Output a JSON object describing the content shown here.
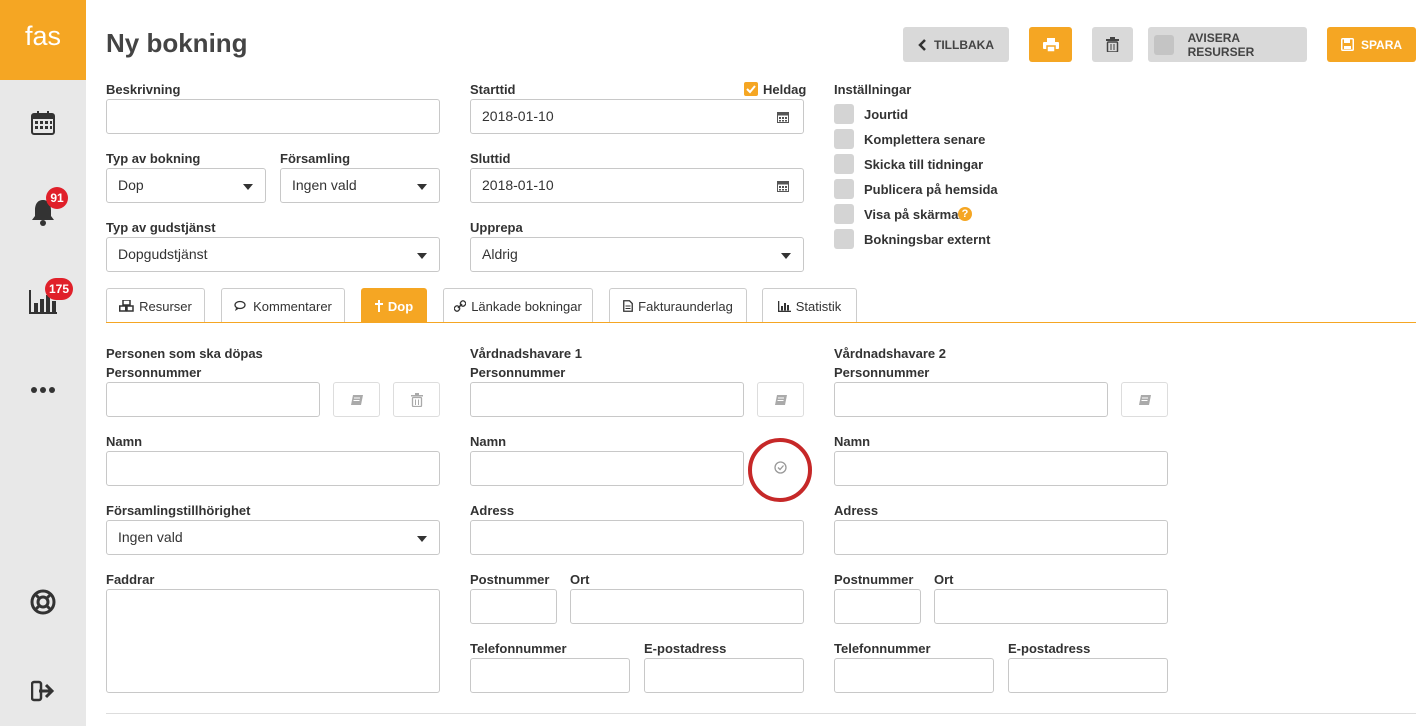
{
  "sidebar": {
    "logo": "fas",
    "notifications_count": "91",
    "stats_count": "175"
  },
  "header": {
    "title": "Ny bokning",
    "back_label": "TILLBAKA",
    "notify_label": "AVISERA RESURSER",
    "save_label": "SPARA"
  },
  "form": {
    "description_label": "Beskrivning",
    "booking_type_label": "Typ av bokning",
    "booking_type_value": "Dop",
    "parish_label": "Församling",
    "parish_value": "Ingen vald",
    "service_type_label": "Typ av gudstjänst",
    "service_type_value": "Dopgudstjänst",
    "start_label": "Starttid",
    "allday_label": "Heldag",
    "start_value": "2018-01-10",
    "end_label": "Sluttid",
    "end_value": "2018-01-10",
    "repeat_label": "Upprepa",
    "repeat_value": "Aldrig"
  },
  "settings": {
    "title": "Inställningar",
    "items": [
      "Jourtid",
      "Komplettera senare",
      "Skicka till tidningar",
      "Publicera på hemsida",
      "Visa på skärmar",
      "Bokningsbar externt"
    ]
  },
  "tabs": [
    "Resurser",
    "Kommentarer",
    "Dop",
    "Länkade bokningar",
    "Fakturaunderlag",
    "Statistik"
  ],
  "baptism": {
    "person_heading": "Personen som ska döpas",
    "guardian1_heading": "Vårdnadshavare 1",
    "guardian2_heading": "Vårdnadshavare 2",
    "ssn_label": "Personnummer",
    "name_label": "Namn",
    "parish_membership_label": "Församlingstillhörighet",
    "parish_membership_value": "Ingen vald",
    "godparents_label": "Faddrar",
    "address_label": "Adress",
    "zip_label": "Postnummer",
    "city_label": "Ort",
    "phone_label": "Telefonnummer",
    "email_label": "E-postadress"
  },
  "colors": {
    "accent": "#f5a623",
    "badge": "#e0202a",
    "highlight_circle": "#c62828"
  }
}
